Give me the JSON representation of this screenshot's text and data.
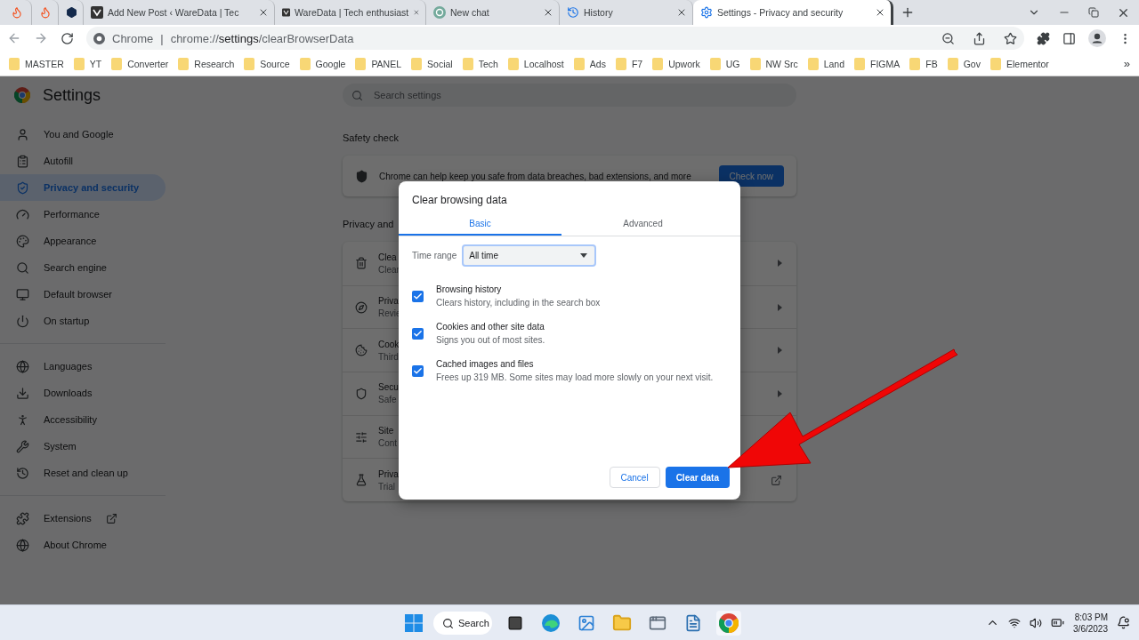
{
  "browser": {
    "tabs": [
      {
        "selected": false
      },
      {
        "selected": false
      },
      {
        "selected": false
      },
      {
        "title": "Add New Post ‹ WareData | Tec",
        "selected": false
      },
      {
        "title": "WareData | Tech enthusiast",
        "selected": false
      },
      {
        "title": "New chat",
        "selected": false
      },
      {
        "title": "History",
        "selected": false
      },
      {
        "title": "Settings - Privacy and security",
        "selected": true
      }
    ],
    "omnibox": {
      "site": "Chrome",
      "separator": "|",
      "url": "chrome://**settings**/clearBrowserData"
    },
    "bookmarks": [
      "MASTER",
      "YT",
      "Converter",
      "Research",
      "Source",
      "Google",
      "PANEL",
      "Social",
      "Tech",
      "Localhost",
      "Ads",
      "F7",
      "Upwork",
      "UG",
      "NW Src",
      "Land",
      "FIGMA",
      "FB",
      "Gov",
      "Elementor"
    ],
    "bookmarks_more": "»"
  },
  "settings": {
    "title": "Settings",
    "search": {
      "placeholder": "Search settings"
    },
    "sidebar": {
      "groups": [
        {
          "items": [
            {
              "label": "You and Google",
              "selected": false
            },
            {
              "label": "Autofill",
              "selected": false
            },
            {
              "label": "Privacy and security",
              "selected": true
            },
            {
              "label": "Performance",
              "selected": false
            },
            {
              "label": "Appearance",
              "selected": false
            },
            {
              "label": "Search engine",
              "selected": false
            },
            {
              "label": "Default browser",
              "selected": false
            },
            {
              "label": "On startup",
              "selected": false
            }
          ]
        },
        {
          "items": [
            {
              "label": "Languages",
              "selected": false
            },
            {
              "label": "Downloads",
              "selected": false
            },
            {
              "label": "Accessibility",
              "selected": false
            },
            {
              "label": "System",
              "selected": false
            },
            {
              "label": "Reset and clean up",
              "selected": false
            }
          ]
        },
        {
          "items": [
            {
              "label": "Extensions",
              "selected": false,
              "external": true
            },
            {
              "label": "About Chrome",
              "selected": false,
              "external": false
            }
          ]
        }
      ]
    },
    "safety_check": {
      "heading": "Safety check",
      "text": "Chrome can help keep you safe from data breaches, bad extensions, and more",
      "button": "Check now"
    },
    "privacy": {
      "heading": "Privacy and",
      "rows": [
        {
          "title": "Clea",
          "subtitle": "Clear",
          "kind": "arrow"
        },
        {
          "title": "Priva",
          "subtitle": "Revie",
          "kind": "arrow"
        },
        {
          "title": "Cook",
          "subtitle": "Third",
          "kind": "arrow"
        },
        {
          "title": "Secu",
          "subtitle": "Safe",
          "kind": "arrow"
        },
        {
          "title": "Site",
          "subtitle": "Cont",
          "kind": "plain"
        },
        {
          "title": "Priva",
          "subtitle": "Trial",
          "kind": "external"
        }
      ]
    }
  },
  "dialog": {
    "title": "Clear browsing data",
    "tabs": [
      {
        "label": "Basic",
        "selected": true
      },
      {
        "label": "Advanced",
        "selected": false
      }
    ],
    "time_range": {
      "label": "Time range",
      "value": "All time"
    },
    "options": [
      {
        "title": "Browsing history",
        "description": "Clears history, including in the search box",
        "checked": true
      },
      {
        "title": "Cookies and other site data",
        "description": "Signs you out of most sites.",
        "checked": true
      },
      {
        "title": "Cached images and files",
        "description": "Frees up 319 MB. Some sites may load more slowly on your next visit.",
        "checked": true
      }
    ],
    "buttons": {
      "cancel": "Cancel",
      "confirm": "Clear data"
    }
  },
  "taskbar": {
    "search": "Search",
    "time": "8:03 PM",
    "date": "3/6/2023"
  }
}
